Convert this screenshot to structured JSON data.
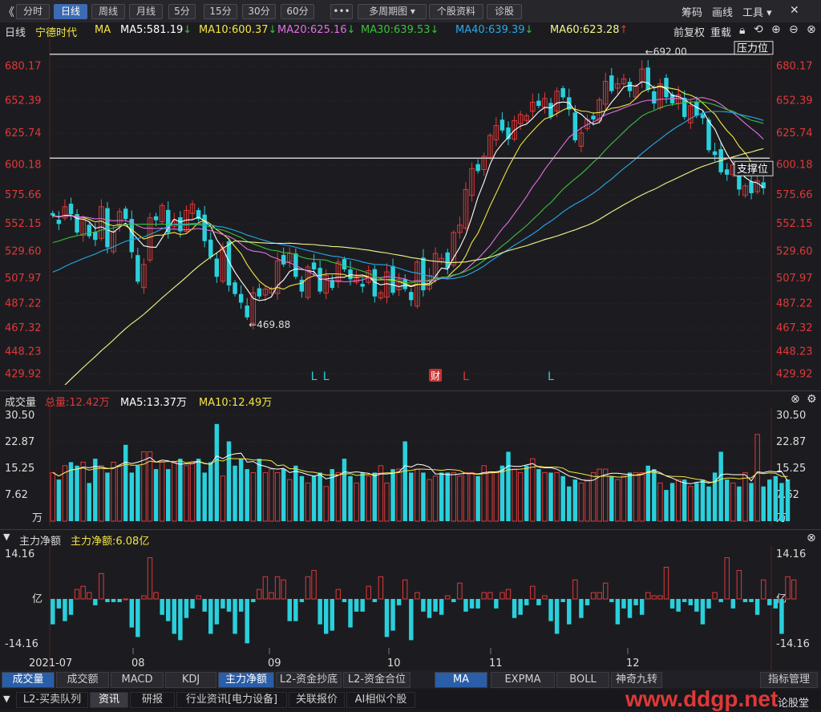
{
  "toolbar": {
    "collapse": "《",
    "periods": [
      "分时",
      "日线",
      "周线",
      "月线",
      "5分",
      "15分",
      "30分",
      "60分"
    ],
    "active_period": "日线",
    "more": "•••",
    "multi_period": "多周期图 ▾",
    "stock_info": "个股资料",
    "diagnose": "诊股",
    "right": [
      "筹码",
      "画线",
      "工具 ▾"
    ]
  },
  "header": {
    "period": "日线",
    "stock_name": "宁德时代",
    "indicator": "MA",
    "ma_items": [
      {
        "label": "MA5:581.19",
        "arrow": "↓",
        "color": "#ffffff"
      },
      {
        "label": "MA10:600.37",
        "arrow": "↓",
        "color": "#f5e642"
      },
      {
        "label": "MA20:625.16",
        "arrow": "↓",
        "color": "#e070e0"
      },
      {
        "label": "MA30:639.53",
        "arrow": "↓",
        "color": "#3cbf3c"
      },
      {
        "label": "MA40:639.39",
        "arrow": "↓",
        "color": "#28a8e8"
      },
      {
        "label": "MA60:623.28",
        "arrow": "↑",
        "color": "#f5f58a"
      }
    ],
    "adjust": "前复权",
    "replay": "重载"
  },
  "colors": {
    "up": "#e03838",
    "down": "#2ad0dc",
    "bg": "#1c1c20",
    "grid": "#3a2a2a"
  },
  "chart_data": [
    {
      "type": "candlestick",
      "title": "宁德时代 日线",
      "y_ticks": [
        680.17,
        652.39,
        625.74,
        600.18,
        575.66,
        552.15,
        529.6,
        507.97,
        487.22,
        467.32,
        448.23,
        429.92
      ],
      "ylim": [
        425,
        695
      ],
      "x_labels": [
        "2021-07",
        "08",
        "09",
        "10",
        "11",
        "12"
      ],
      "annotations": {
        "high": "692.00",
        "low": "469.88",
        "resistance": "压力位",
        "support": "支撑位",
        "resistance_level": 690,
        "support_level": 605.5
      },
      "markers": [
        {
          "i": 43,
          "text": "L",
          "color": "#2ad0dc"
        },
        {
          "i": 45,
          "text": "L",
          "color": "#2ad0dc"
        },
        {
          "i": 63,
          "text": "财",
          "color": "#e03838"
        },
        {
          "i": 68,
          "text": "L",
          "color": "#e03838"
        },
        {
          "i": 82,
          "text": "L",
          "color": "#2ad0dc"
        }
      ],
      "closes": [
        559,
        552,
        566,
        560,
        545,
        556,
        542,
        539,
        566,
        533,
        546,
        562,
        556,
        529,
        505,
        519,
        557,
        555,
        567,
        545,
        555,
        546,
        563,
        568,
        556,
        538,
        525,
        509,
        533,
        502,
        495,
        488,
        476,
        496,
        493,
        499,
        499,
        522,
        519,
        528,
        509,
        497,
        517,
        515,
        497,
        510,
        500,
        521,
        515,
        507,
        508,
        501,
        514,
        493,
        496,
        513,
        496,
        507,
        499,
        490,
        521,
        498,
        510,
        528,
        524,
        516,
        545,
        551,
        580,
        597,
        595,
        607,
        624,
        632,
        628,
        621,
        636,
        641,
        640,
        651,
        648,
        654,
        639,
        660,
        655,
        645,
        620,
        626,
        637,
        637,
        653,
        668,
        660,
        666,
        670,
        660,
        664,
        678,
        661,
        650,
        666,
        655,
        650,
        657,
        639,
        648,
        640,
        638,
        612,
        608,
        594,
        592,
        600,
        580,
        583,
        577,
        587,
        581
      ]
    },
    {
      "type": "bar",
      "title": "成交量",
      "total": "总量:12.42万",
      "ma5": "MA5:13.37万",
      "ma10": "MA10:12.49万",
      "y_ticks": [
        "30.50",
        "22.87",
        "15.25",
        "7.62"
      ],
      "unit": "万",
      "ylim": [
        0,
        30.5
      ],
      "values": [
        14,
        12,
        16,
        17,
        16,
        17,
        11,
        18,
        16,
        14,
        17,
        16,
        22,
        14,
        16,
        20,
        20,
        15,
        17,
        15,
        17,
        18,
        16,
        17,
        18,
        14,
        17,
        28,
        13,
        23,
        16,
        18,
        15,
        14,
        18,
        14,
        15,
        14,
        15,
        12,
        16,
        13,
        11,
        13,
        14,
        10,
        15,
        14,
        18,
        13,
        11,
        14,
        13,
        14,
        16,
        11,
        15,
        15,
        23,
        14,
        15,
        14,
        12,
        13,
        14,
        14,
        14,
        13,
        14,
        14,
        13,
        16,
        14,
        14,
        16,
        20,
        15,
        14,
        16,
        18,
        15,
        14,
        14,
        14,
        13,
        10,
        12,
        11,
        12,
        14,
        15,
        15,
        13,
        12,
        13,
        14,
        14,
        14,
        16,
        15,
        11,
        9,
        11,
        12,
        12,
        10,
        11,
        12,
        10,
        14,
        20,
        12,
        11,
        10,
        14,
        11,
        25,
        10,
        12,
        13,
        11,
        12
      ]
    },
    {
      "type": "bar",
      "title": "主力净额",
      "value": "主力净额:6.08亿",
      "y_ticks": [
        "14.16",
        "亿",
        "-14.16"
      ],
      "ylim": [
        -14.16,
        14.16
      ],
      "values": [
        -8,
        -3,
        -7,
        -5,
        3,
        4,
        2,
        -2,
        8,
        -1,
        -1,
        -1,
        0,
        -9,
        -12,
        1,
        13,
        2,
        -5,
        -7,
        -11,
        -13,
        -6,
        -3,
        1,
        -4,
        -11,
        -8,
        -3,
        -4,
        -11,
        -4,
        -14,
        -1,
        3,
        7,
        2,
        7,
        6,
        -7,
        -7,
        -1,
        7,
        9,
        -8,
        -11,
        -10,
        3,
        -1,
        -9,
        -4,
        -4,
        4,
        -1,
        7,
        -12,
        -10,
        -2,
        6,
        -13,
        2,
        -4,
        -6,
        -4,
        -5,
        1,
        -1,
        5,
        -4,
        -3,
        -3,
        2,
        2,
        -3,
        2,
        3,
        -6,
        -5,
        -2,
        4,
        -2,
        1,
        -7,
        -11,
        -1,
        -8,
        6,
        -6,
        -2,
        2,
        2,
        5,
        -1,
        -8,
        -3,
        -6,
        -2,
        -5,
        2,
        1,
        1,
        10,
        -3,
        -4,
        -1,
        -2,
        -4,
        -8,
        -3,
        2,
        -1,
        13,
        -3,
        9,
        -1,
        -1,
        -5,
        6,
        -2,
        -3,
        -11,
        7,
        6
      ]
    }
  ],
  "bottom_tabs": [
    "成交量",
    "成交额",
    "MACD",
    "KDJ",
    "主力净额",
    "L2-资金抄底",
    "L2-资金合位"
  ],
  "bottom_tabs_active": [
    "成交量",
    "主力净额"
  ],
  "indicator_tabs": [
    "MA",
    "EXPMA",
    "BOLL",
    "神奇九转"
  ],
  "indicator_tabs_active": "MA",
  "indicator_manage": "指标管理",
  "footer_tabs": [
    "L2-买卖队列",
    "资讯",
    "研报",
    "行业资讯[电力设备]",
    "关联报价",
    "AI相似个股"
  ],
  "footer_active": "资讯",
  "footer_right": "论股堂",
  "watermark": "www.ddgp.net"
}
